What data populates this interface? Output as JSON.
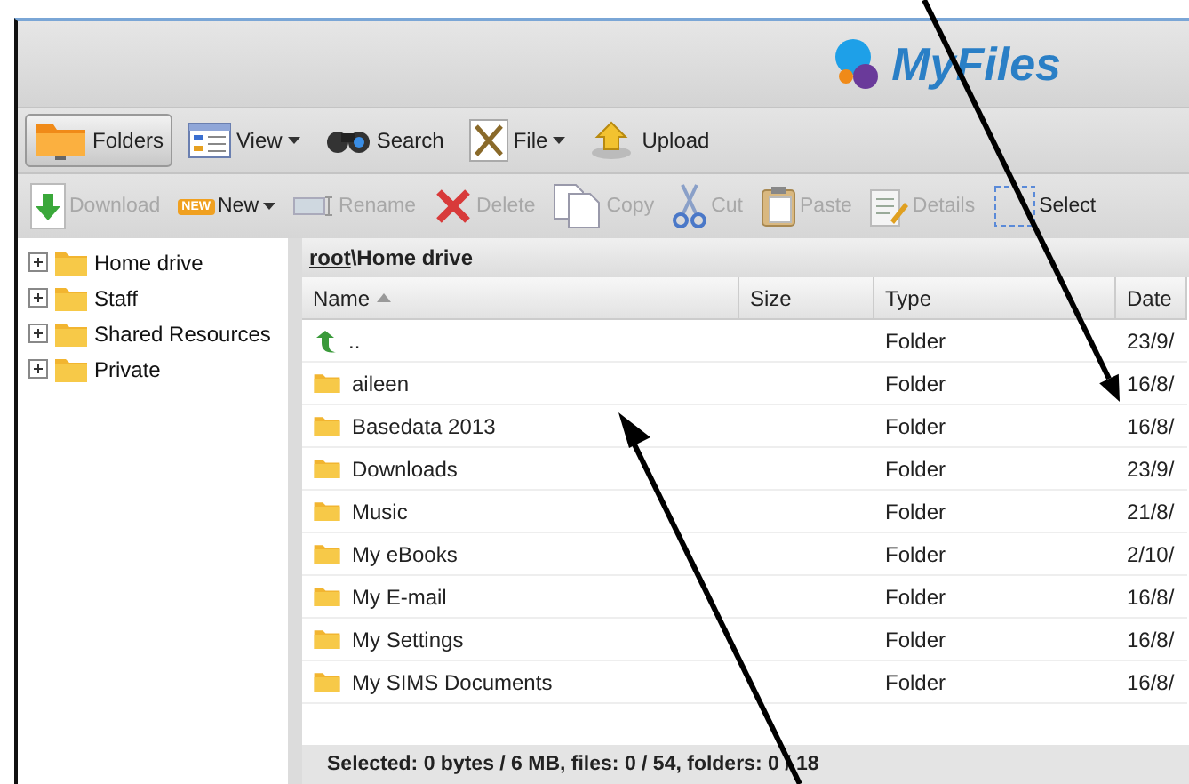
{
  "app": {
    "logo": "MyFiles"
  },
  "toolbar": [
    {
      "label": "Folders",
      "kind": "folders",
      "selected": true,
      "dropdown": false
    },
    {
      "label": "View",
      "kind": "view",
      "selected": false,
      "dropdown": true
    },
    {
      "label": "Search",
      "kind": "search",
      "selected": false,
      "dropdown": false
    },
    {
      "label": "File",
      "kind": "file",
      "selected": false,
      "dropdown": true
    },
    {
      "label": "Upload",
      "kind": "upload",
      "selected": false,
      "dropdown": false
    }
  ],
  "actions": [
    {
      "label": "Download",
      "kind": "download",
      "disabled": true,
      "dropdown": false
    },
    {
      "label": "New",
      "kind": "new",
      "badge": "NEW",
      "disabled": false,
      "dropdown": true
    },
    {
      "label": "Rename",
      "kind": "rename",
      "disabled": true,
      "dropdown": false
    },
    {
      "label": "Delete",
      "kind": "delete",
      "disabled": true,
      "dropdown": false
    },
    {
      "label": "Copy",
      "kind": "copy",
      "disabled": true,
      "dropdown": false
    },
    {
      "label": "Cut",
      "kind": "cut",
      "disabled": true,
      "dropdown": false
    },
    {
      "label": "Paste",
      "kind": "paste",
      "disabled": true,
      "dropdown": false
    },
    {
      "label": "Details",
      "kind": "details",
      "disabled": true,
      "dropdown": false
    },
    {
      "label": "Select",
      "kind": "select",
      "disabled": false,
      "dropdown": false
    }
  ],
  "tree": [
    {
      "label": "Home drive",
      "expanded": false
    },
    {
      "label": "Staff",
      "expanded": false
    },
    {
      "label": "Shared Resources",
      "expanded": false
    },
    {
      "label": "Private",
      "expanded": false
    }
  ],
  "path": {
    "root": "root",
    "separator": "\\",
    "current": "Home drive"
  },
  "table": {
    "columns": [
      {
        "label": "Name",
        "sorted": true
      },
      {
        "label": "Size",
        "sorted": false
      },
      {
        "label": "Type",
        "sorted": false
      },
      {
        "label": "Date",
        "sorted": false
      }
    ],
    "rows": [
      {
        "kind": "up",
        "name": "..",
        "type": "Folder",
        "date": "23/9/"
      },
      {
        "kind": "folder",
        "name": "aileen",
        "type": "Folder",
        "date": "16/8/"
      },
      {
        "kind": "folder",
        "name": "Basedata 2013",
        "type": "Folder",
        "date": "16/8/"
      },
      {
        "kind": "folder",
        "name": "Downloads",
        "type": "Folder",
        "date": "23/9/"
      },
      {
        "kind": "folder",
        "name": "Music",
        "type": "Folder",
        "date": "21/8/"
      },
      {
        "kind": "folder",
        "name": "My eBooks",
        "type": "Folder",
        "date": "2/10/"
      },
      {
        "kind": "folder",
        "name": "My E-mail",
        "type": "Folder",
        "date": "16/8/"
      },
      {
        "kind": "folder",
        "name": "My Settings",
        "type": "Folder",
        "date": "16/8/"
      },
      {
        "kind": "folder",
        "name": "My SIMS Documents",
        "type": "Folder",
        "date": "16/8/"
      }
    ]
  },
  "status_bar": "Selected: 0 bytes / 6 MB, files: 0 / 54, folders: 0 / 18"
}
